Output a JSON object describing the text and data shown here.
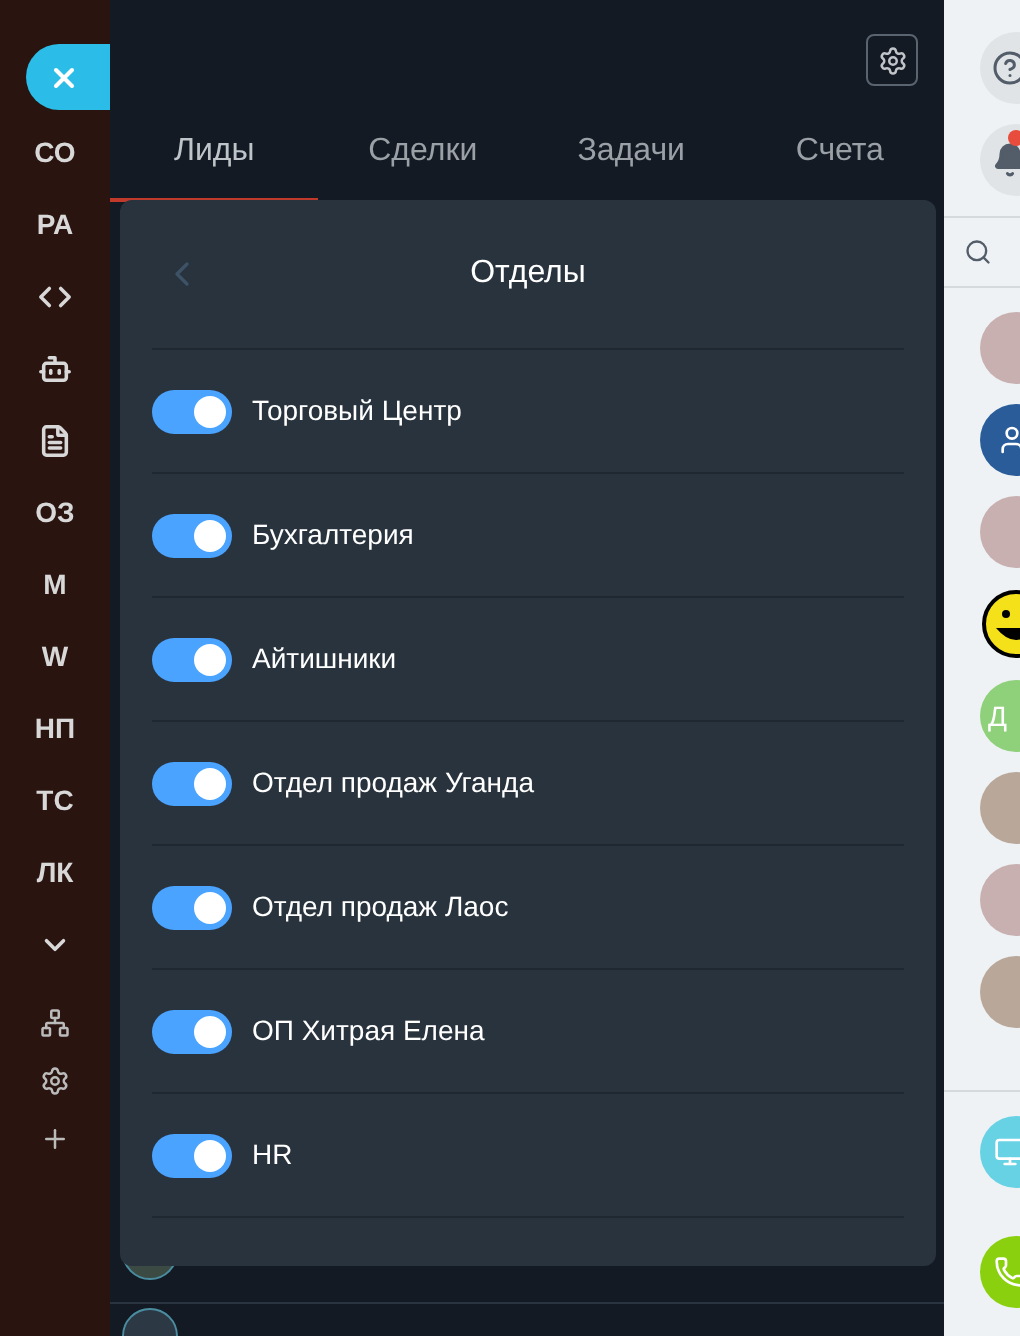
{
  "sidebar": {
    "items": [
      {
        "kind": "label",
        "text": "СО"
      },
      {
        "kind": "label",
        "text": "РА"
      },
      {
        "kind": "icon"
      },
      {
        "kind": "icon"
      },
      {
        "kind": "icon"
      },
      {
        "kind": "label",
        "text": "ОЗ"
      },
      {
        "kind": "label",
        "text": "М"
      },
      {
        "kind": "label",
        "text": "W"
      },
      {
        "kind": "label",
        "text": "НП"
      },
      {
        "kind": "label",
        "text": "ТС"
      },
      {
        "kind": "label",
        "text": "ЛК"
      },
      {
        "kind": "icon"
      }
    ]
  },
  "tabs": [
    {
      "label": "Лиды",
      "selected": true
    },
    {
      "label": "Сделки",
      "selected": false
    },
    {
      "label": "Задачи",
      "selected": false
    },
    {
      "label": "Счета",
      "selected": false
    }
  ],
  "dialog": {
    "title": "Отделы",
    "departments": [
      {
        "name": "Торговый Центр",
        "on": true
      },
      {
        "name": "Бухгалтерия",
        "on": true
      },
      {
        "name": "Айтишники",
        "on": true
      },
      {
        "name": "Отдел продаж Уганда",
        "on": true
      },
      {
        "name": "Отдел продаж Лаос",
        "on": true
      },
      {
        "name": "ОП Хитрая Елена",
        "on": true
      },
      {
        "name": "HR",
        "on": true
      }
    ]
  },
  "right_rail": {
    "contacts": [
      {
        "kind": "photo"
      },
      {
        "kind": "group"
      },
      {
        "kind": "photo"
      },
      {
        "kind": "smiley"
      },
      {
        "kind": "initials",
        "text": "Д"
      },
      {
        "kind": "photo"
      },
      {
        "kind": "photo"
      },
      {
        "kind": "photo"
      }
    ]
  }
}
